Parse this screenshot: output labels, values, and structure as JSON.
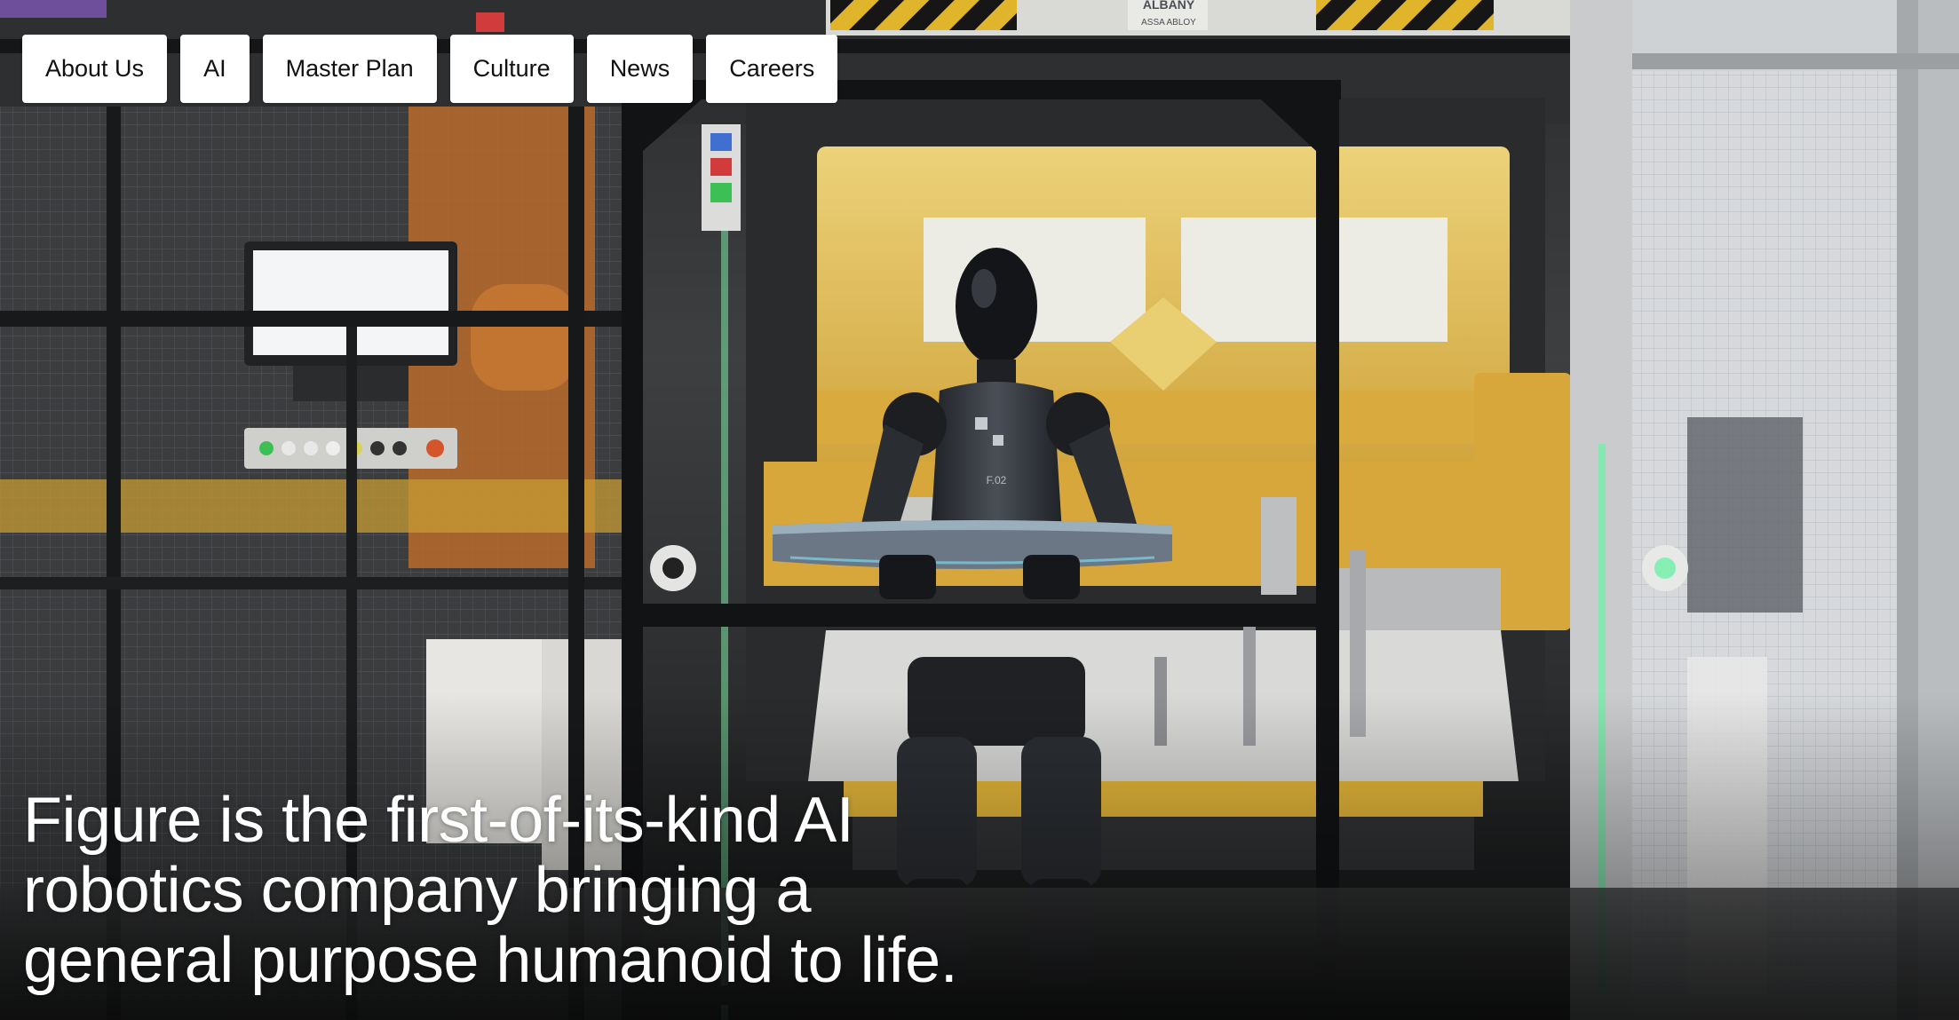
{
  "nav": {
    "items": [
      {
        "label": "About Us"
      },
      {
        "label": "AI"
      },
      {
        "label": "Master Plan"
      },
      {
        "label": "Culture"
      },
      {
        "label": "News"
      },
      {
        "label": "Careers"
      }
    ]
  },
  "hero": {
    "headline_line1": "Figure is the first-of-its-kind AI",
    "headline_line2": "robotics company bringing a",
    "headline_line3": "general purpose humanoid to life.",
    "signage_brand": "ALBANY",
    "signage_sub": "ASSA ABLOY",
    "robot_label": "F.02"
  },
  "colors": {
    "fixture_yellow": "#e3c158",
    "robot_dark": "#2b2e33",
    "cage_black": "#15171a",
    "status_green": "#6ff0a8",
    "nav_bg": "#ffffff",
    "text_white": "#ffffff"
  }
}
